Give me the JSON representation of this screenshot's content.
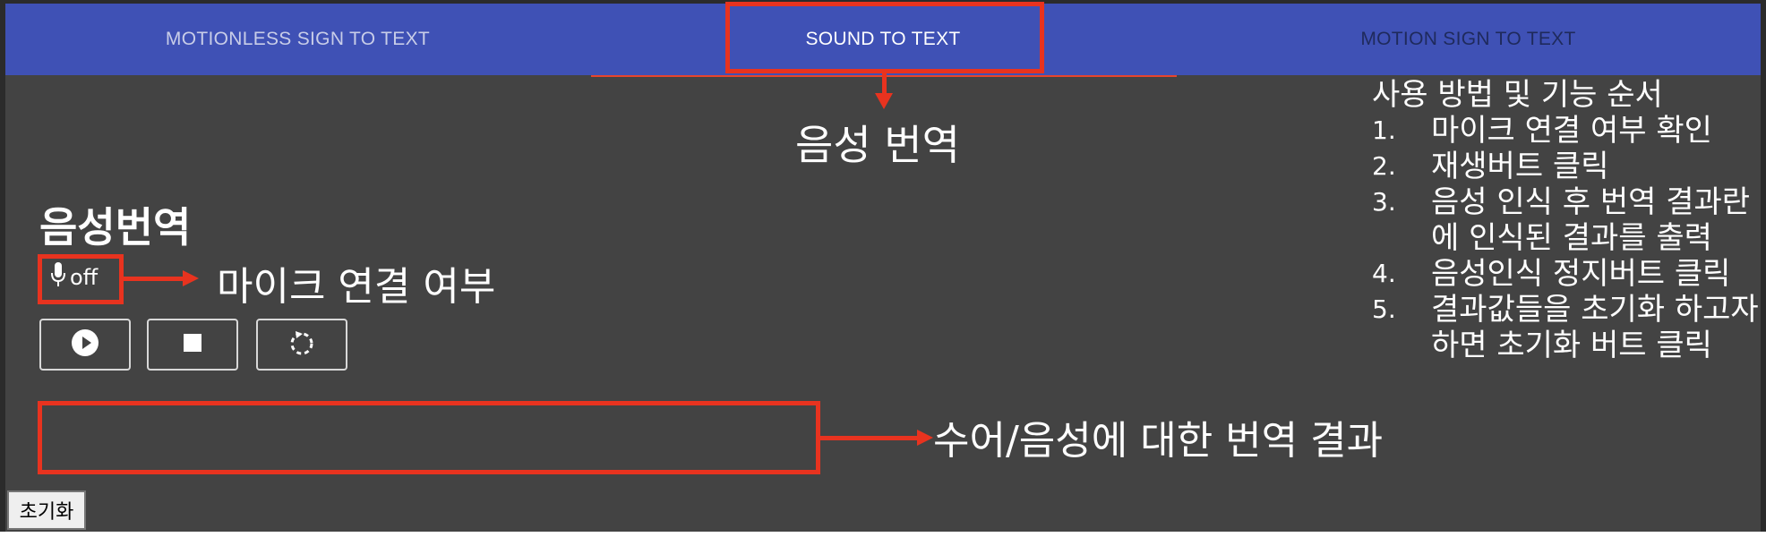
{
  "tabs": [
    {
      "label": "MOTIONLESS SIGN TO TEXT"
    },
    {
      "label": "SOUND TO TEXT"
    },
    {
      "label": "MOTION SIGN TO TEXT"
    }
  ],
  "annotations": {
    "tab_target": "음성 번역",
    "mic_status": "마이크 연결 여부",
    "result_box": "수어/음성에 대한 번역 결과"
  },
  "section": {
    "heading": "음성번역",
    "mic_state": "off"
  },
  "controls": {
    "play_icon": "play-circle-icon",
    "stop_icon": "stop-icon",
    "reset_icon": "rotate-dashed-icon"
  },
  "reset_button_label": "초기화",
  "instructions": {
    "title": "사용 방법 및 기능 순서",
    "items": [
      {
        "num": "1.",
        "text": "마이크 연결 여부 확인"
      },
      {
        "num": "2.",
        "text": "재생버트 클릭"
      },
      {
        "num": "3.",
        "text": "음성 인식 후 번역 결과란에 인식된 결과를 출력"
      },
      {
        "num": "4.",
        "text": "음성인식 정지버트 클릭"
      },
      {
        "num": "5.",
        "text": "결과값들을 초기화 하고자하면 초기화 버트 클릭"
      }
    ]
  },
  "colors": {
    "tabbar": "#3f51b5",
    "annotation": "#e8331f",
    "background": "#434343"
  }
}
